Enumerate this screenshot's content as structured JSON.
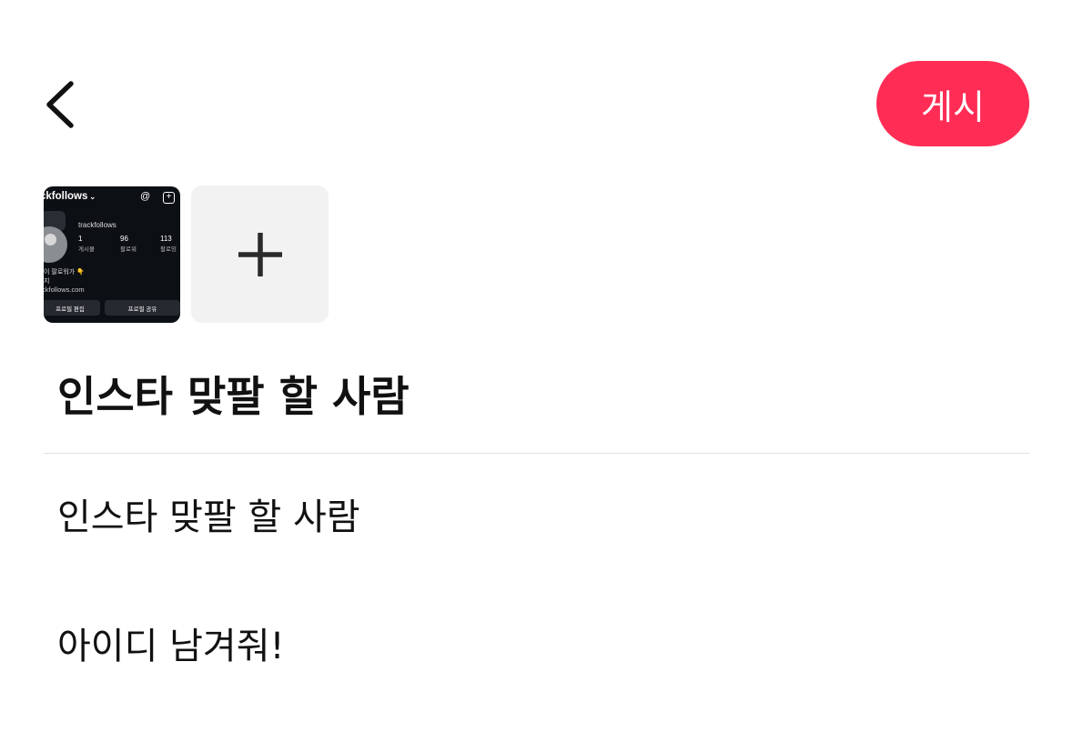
{
  "header": {
    "back_icon": "chevron-left-icon",
    "post_label": "게시",
    "accent_color": "#ff2d55"
  },
  "attachments": {
    "thumbnail": {
      "username": "ckfollows",
      "handle": "trackfollows",
      "stats": [
        {
          "value": "1",
          "label": "게시물"
        },
        {
          "value": "96",
          "label": "팔로워"
        },
        {
          "value": "113",
          "label": "팔로잉"
        }
      ],
      "bio_line1": "이 팔로워가 👇",
      "bio_line2": "지",
      "link": "ckfollows.com",
      "button1": "프로필 편집",
      "button2": "프로필 공유"
    },
    "add_icon": "plus-icon"
  },
  "post": {
    "title": "인스타 맞팔 할 사람",
    "body_line1": "인스타 맞팔 할 사람",
    "body_line2": "아이디 남겨줘!"
  }
}
